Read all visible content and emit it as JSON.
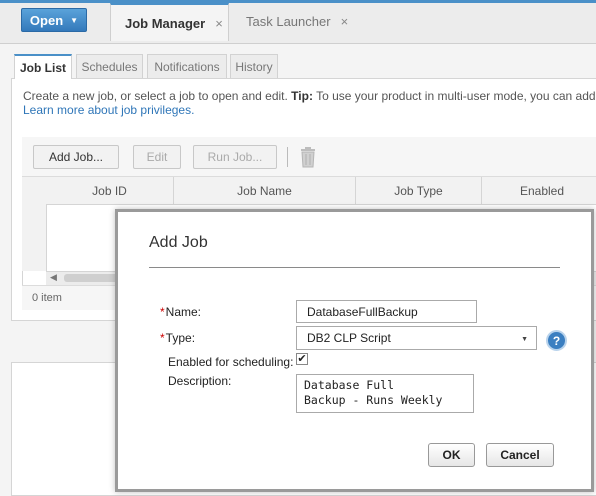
{
  "header": {
    "open_label": "Open",
    "tabs": [
      {
        "label": "Job Manager",
        "close": "×"
      },
      {
        "label": "Task Launcher",
        "close": "×"
      }
    ]
  },
  "subtabs": [
    "Job List",
    "Schedules",
    "Notifications",
    "History"
  ],
  "intro": {
    "text": "Create a new job, or select a job to open and edit. ",
    "tip_label": "Tip:",
    "tip_text": " To use your product in multi-user mode, you can add",
    "link": "Learn more about job privileges."
  },
  "toolbar": {
    "add_job": "Add Job...",
    "edit": "Edit",
    "run_job": "Run Job..."
  },
  "table": {
    "columns": [
      "Job ID",
      "Job Name",
      "Job Type",
      "Enabled"
    ],
    "footer": "0 item"
  },
  "dialog": {
    "title": "Add Job",
    "required_mark": "*",
    "name_label": "Name:",
    "name_value": "DatabaseFullBackup",
    "type_label": "Type:",
    "type_value": "DB2 CLP Script",
    "help": "?",
    "enabled_label": "Enabled for scheduling:",
    "enabled_checked": true,
    "check_glyph": "✔",
    "description_label": "Description:",
    "description_value": "Database Full\nBackup - Runs Weekly",
    "ok": "OK",
    "cancel": "Cancel"
  },
  "colors": {
    "accent": "#4a90c8",
    "link": "#2f76b8",
    "required": "#cc0000"
  }
}
